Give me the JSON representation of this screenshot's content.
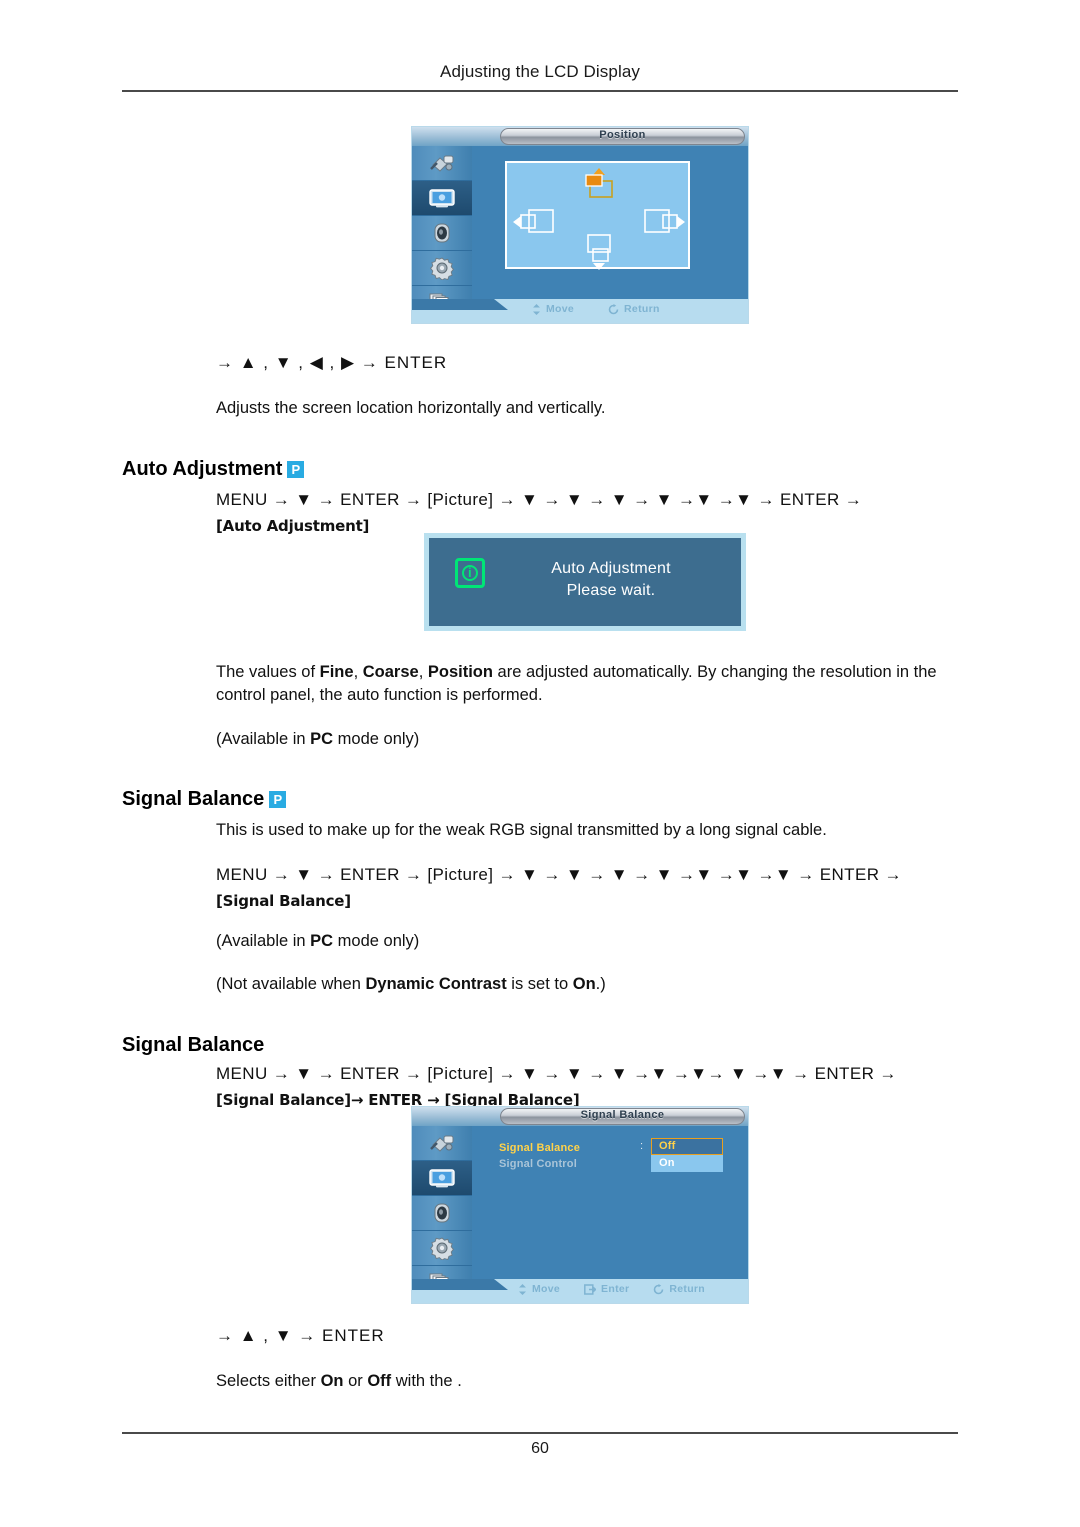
{
  "header": {
    "title": "Adjusting the LCD Display"
  },
  "footer": {
    "page_number": "60"
  },
  "position_osd": {
    "title": "Position",
    "hints": [
      {
        "icon": "move-icon",
        "label": "Move"
      },
      {
        "icon": "return-icon",
        "label": "Return"
      }
    ],
    "rail_icons": [
      "input-plug-icon",
      "picture-icon",
      "sound-speaker-icon",
      "setup-gear-icon",
      "multi-control-pages-icon"
    ],
    "active_rail_index": 1
  },
  "position_nav": {
    "line": "→ ▲ , ▼ , ◀ , ▶ → ENTER",
    "description": "Adjusts the screen location horizontally and vertically."
  },
  "auto_adjustment": {
    "heading": "Auto Adjustment",
    "badge": "P",
    "menu_path_line1": "MENU → ▼ → ENTER → [Picture] → ▼ → ▼ → ▼ → ▼ →▼ →▼ → ENTER →",
    "menu_path_line2": "[Auto Adjustment]",
    "menu_tokens": {
      "menu": "MENU",
      "enter": "ENTER",
      "picture": "[Picture]",
      "target": "[Auto Adjustment]"
    },
    "dialog": {
      "title": "Auto Adjustment",
      "subtitle": "Please wait.",
      "icon": "info-icon"
    },
    "paragraph_html": "The values of <b>Fine</b>, <b>Coarse</b>, <b>Position</b> are adjusted automatically. By changing the resolution in the control panel, the auto function is performed.",
    "note": "(Available in PC mode only)",
    "note_bold": "PC"
  },
  "signal_balance_p": {
    "heading": "Signal Balance",
    "badge": "P",
    "description": "This is used to make up for the weak RGB signal transmitted by a long signal cable.",
    "menu_path_line1": "MENU → ▼ → ENTER → [Picture] → ▼ → ▼ → ▼ → ▼ →▼ →▼ →▼ → ENTER →",
    "menu_path_line2": "[Signal Balance]",
    "note_pc": "(Available in PC mode only)",
    "note_dynamic": "(Not available when Dynamic Contrast is set to On.)"
  },
  "signal_balance": {
    "heading": "Signal Balance",
    "menu_path_line1": "MENU → ▼ → ENTER → [Picture] → ▼ → ▼ → ▼ →▼ →▼→ ▼ →▼ → ENTER →",
    "menu_path_line2": "[Signal Balance]→ ENTER → [Signal Balance]",
    "osd": {
      "title": "Signal Balance",
      "rows": [
        {
          "label": "Signal Balance",
          "state": "selected"
        },
        {
          "label": "Signal Control",
          "state": "dimmed"
        }
      ],
      "colon": ":",
      "options": [
        {
          "label": "Off",
          "state": "highlighted-border"
        },
        {
          "label": "On",
          "state": "highlighted-fill"
        }
      ],
      "hints": [
        {
          "icon": "move-icon",
          "label": "Move"
        },
        {
          "icon": "enter-icon",
          "label": "Enter"
        },
        {
          "icon": "return-icon",
          "label": "Return"
        }
      ]
    },
    "nav_line": "→ ▲ , ▼ → ENTER",
    "description": "Selects either On or Off with the ."
  },
  "colors": {
    "badge_blue": "#29abe2",
    "osd_body_blue": "#3f82b4",
    "osd_panel_blue": "#8ac7ee",
    "osd_hint_bar": "#b7dcef",
    "selected_yellow": "#ffd24a",
    "dialog_bg": "#3d6d8f",
    "dialog_border": "#b9e0ef",
    "info_green": "#00e676",
    "rule_gray": "#4a4a4a"
  }
}
